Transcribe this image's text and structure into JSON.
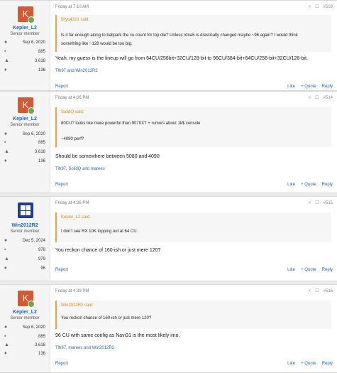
{
  "posts": [
    {
      "date": "Friday at 7:10 AM",
      "number": "#503",
      "user": {
        "avatar_letter": "K",
        "name": "Kepler_L2",
        "title": "Senior member",
        "join": "Sep 6, 2020",
        "messages": "885",
        "reactions": "3,618",
        "points": "136"
      },
      "quote": {
        "author": "Bryo4321 said:",
        "lines": [
          "Is it far enough along to ballpark the cu count for top die? Unless rdna5 is drastically changed maybe ~96 again? I would think",
          "something like ~128 would be too big."
        ]
      },
      "body": [
        "Yeah, my guess is the lineup will go from 64CU/256bit+32CU/128-bit to 96CU/384-bit+64CU/256-bit+32CU/128-bit."
      ],
      "reactions": "Tlh97 and Win2012R2"
    },
    {
      "date": "Friday at 4:06 PM",
      "number": "#514",
      "user": {
        "avatar_letter": "K",
        "name": "Kepler_L2",
        "title": "Senior member",
        "join": "Sep 6, 2020",
        "messages": "885",
        "reactions": "3,618",
        "points": "136"
      },
      "quote": {
        "author": "SolidQ said:",
        "lines": [
          "80CU? looks like more powerful than 9070XT + rumors about 1k$ console",
          "~4090 perf?"
        ]
      },
      "body": [
        "Should be somewhere between 5080 and 4090"
      ],
      "reactions": "Tlh97, SolidQ and marees"
    },
    {
      "date": "Friday at 4:36 PM",
      "number": "#515",
      "user": {
        "avatar_letter": "",
        "name": "Win2012R2",
        "title": "Senior member",
        "join": "Dec 5, 2024",
        "messages": "978",
        "reactions": "979",
        "points": "96"
      },
      "quote": {
        "author": "Kepler_L2 said:",
        "lines": [
          "I don't see RX 10K topping out at 64 CU."
        ]
      },
      "body": [
        "You reckon chance of 160-ish or just mere 120?"
      ],
      "reactions": ""
    },
    {
      "date": "Friday at 4:39 PM",
      "number": "#516",
      "user": {
        "avatar_letter": "K",
        "name": "Kepler_L2",
        "title": "Senior member",
        "join": "Sep 6, 2020",
        "messages": "885",
        "reactions": "3,618",
        "points": "136"
      },
      "quote": {
        "author": "Win2012R2 said:",
        "lines": [
          "You reckon chance of 160-ish or just mere 120?"
        ]
      },
      "body": [
        "96 CU with same config as Navi31 is the most likely imo."
      ],
      "reactions": "Tlh97, marees and Win2012R2"
    }
  ],
  "labels": {
    "report": "Report",
    "like": "Like",
    "quote": "+ Quote",
    "reply": "Reply",
    "share": "<",
    "bookmark": "☐"
  },
  "colors": {
    "accent": "#2b62b0",
    "quote_bar": "#e7a34c",
    "avatar_k": "#d05a34",
    "avatar_win": "#1f3f8a"
  }
}
